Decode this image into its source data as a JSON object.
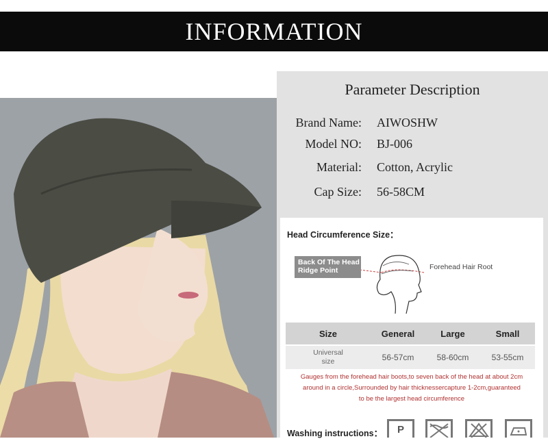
{
  "banner": {
    "title": "INFORMATION"
  },
  "parameters": {
    "title": "Parameter Description",
    "rows": [
      {
        "label": "Brand Name:",
        "value": "AIWOSHW"
      },
      {
        "label": "Model NO:",
        "value": "BJ-006"
      },
      {
        "label": "Material:",
        "value": "Cotton,  Acrylic"
      },
      {
        "label": "Cap Size:",
        "value": "56-58CM"
      }
    ]
  },
  "head_circumference": {
    "title": "Head Circumference Size：",
    "ridge_label": "Back Of The Head Ridge Point",
    "forehead_label": "Forehead Hair Root"
  },
  "size_table": {
    "headers": [
      "Size",
      "General",
      "Large",
      "Small"
    ],
    "row": {
      "size": "Universal size",
      "general": "56-57cm",
      "large": "58-60cm",
      "small": "53-55cm"
    }
  },
  "gauge_note": {
    "line1": "Gauges from the forehead hair boots,to seven back of the head at about 2cm",
    "line2": "around in a circle,Surrounded by hair thicknessercapture 1-2cm,guaranteed",
    "line3": "to be the largest head circumference"
  },
  "washing": {
    "label": "Washing instructions：",
    "icons": [
      "dry-clean-p-icon",
      "no-wash-icon",
      "no-bleach-icon",
      "iron-icon"
    ],
    "p_letter": "P"
  }
}
